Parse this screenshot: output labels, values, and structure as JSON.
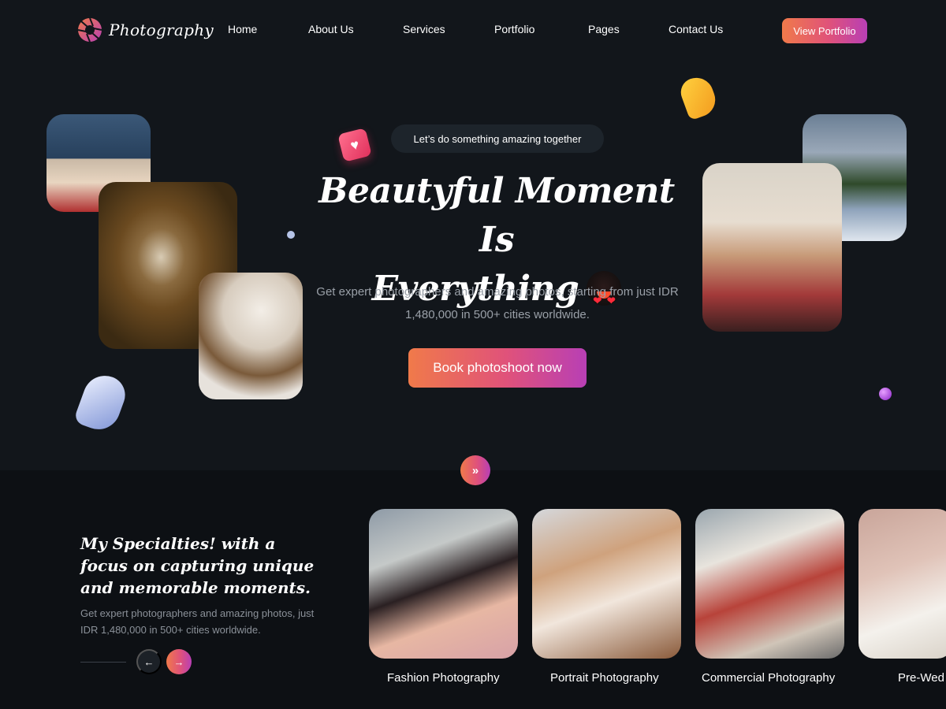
{
  "brand": {
    "name": "Photography",
    "accent_start": "#f07a4a",
    "accent_end": "#b83fb5"
  },
  "nav": {
    "items": [
      {
        "label": "Home"
      },
      {
        "label": "About Us"
      },
      {
        "label": "Services"
      },
      {
        "label": "Portfolio"
      },
      {
        "label": "Pages"
      },
      {
        "label": "Contact Us"
      }
    ],
    "cta_label": "View Portfolio"
  },
  "hero": {
    "pill_text": "Let’s do something amazing together",
    "heading_line1": "Beautyful Moment Is",
    "heading_line2": "Everything",
    "subtitle": "Get expert photographers and amazing photos, starting from just IDR 1,480,000 in 500+ cities worldwide.",
    "cta_label": "Book photoshoot now"
  },
  "specialties": {
    "title": "My Specialties! with a focus on capturing unique and memorable moments.",
    "subtitle": "Get expert photographers and amazing photos, just IDR 1,480,000 in 500+ cities worldwide.",
    "cards": [
      {
        "label": "Fashion Photography"
      },
      {
        "label": "Portrait Photography"
      },
      {
        "label": "Commercial Photography"
      },
      {
        "label": "Pre-Wed"
      }
    ]
  },
  "icons": {
    "scroll": "double-chevron-down-icon",
    "prev": "arrow-left-icon",
    "next": "arrow-right-icon",
    "heart": "heart-icon"
  }
}
